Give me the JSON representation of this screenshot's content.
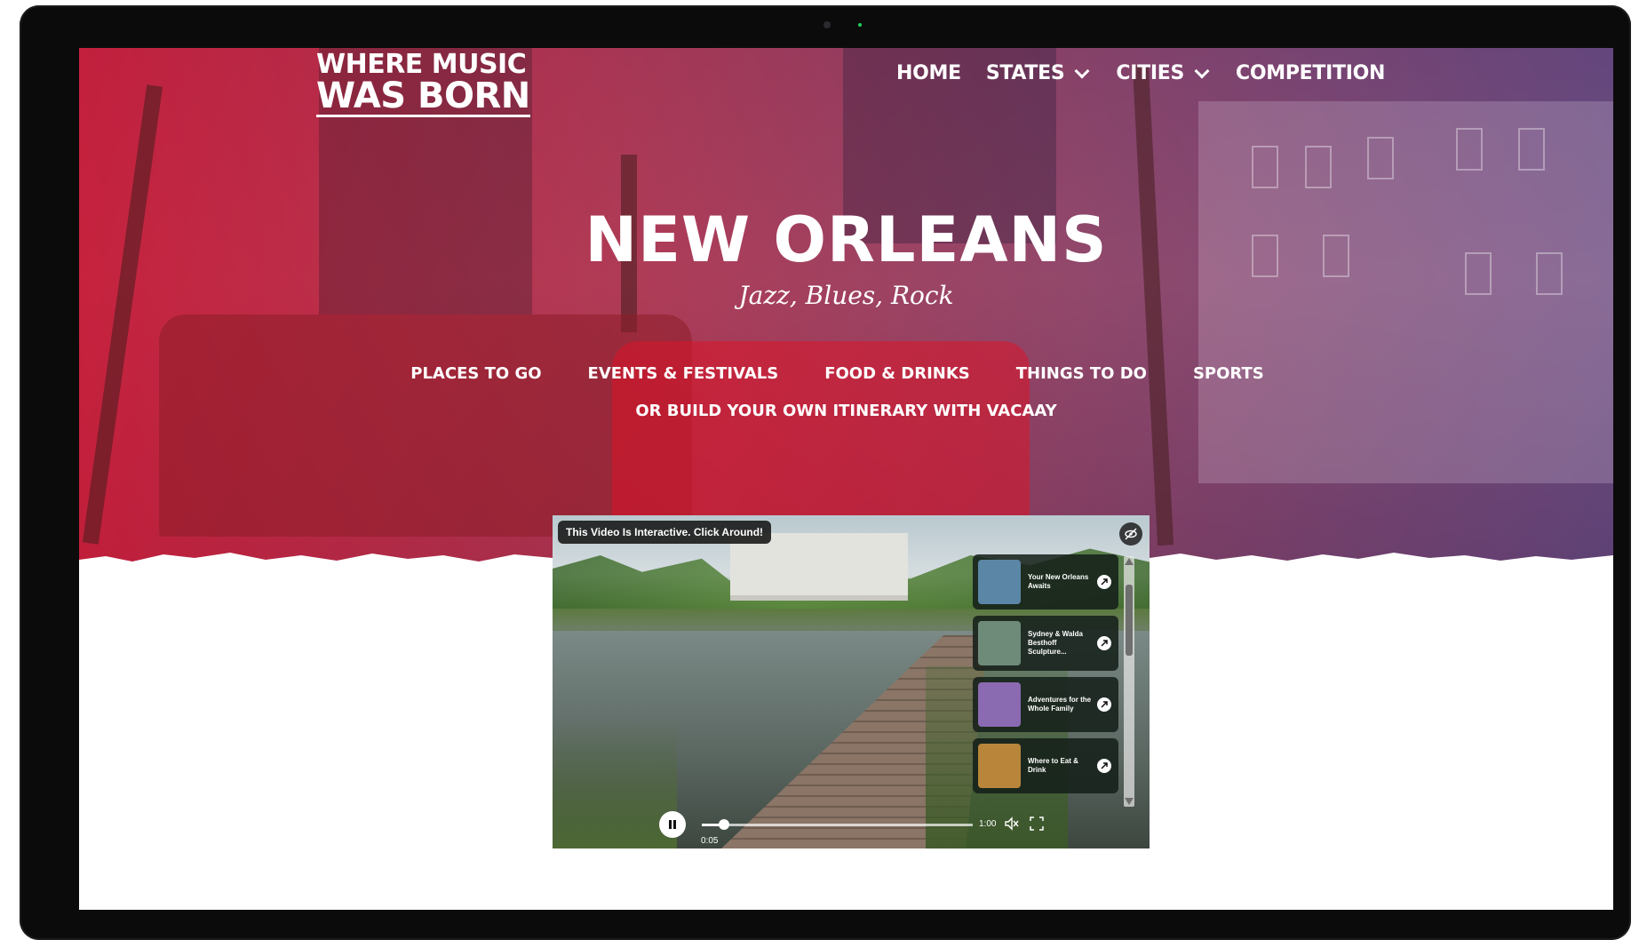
{
  "site": {
    "logo_line1": "WHERE MUSIC",
    "logo_line2": "WAS BORN"
  },
  "nav": {
    "home": "HOME",
    "states": "STATES",
    "cities": "CITIES",
    "competition": "COMPETITION"
  },
  "hero": {
    "title": "NEW ORLEANS",
    "subtitle": "Jazz, Blues, Rock"
  },
  "categories": {
    "places": "PLACES TO GO",
    "events": "EVENTS & FESTIVALS",
    "food": "FOOD & DRINKS",
    "things": "THINGS TO DO",
    "sports": "SPORTS",
    "itinerary": "OR BUILD YOUR OWN ITINERARY WITH VACAAY"
  },
  "video": {
    "badge": "This Video Is Interactive. Click Around!",
    "cards": [
      {
        "title": "Your New Orleans Awaits",
        "thumb_color": "#5b86a6"
      },
      {
        "title": "Sydney & Walda Besthoff Sculpture...",
        "thumb_color": "#6e8b79"
      },
      {
        "title": "Adventures for the Whole Family",
        "thumb_color": "#8a6ab0"
      },
      {
        "title": "Where to Eat & Drink",
        "thumb_color": "#b8853b"
      }
    ],
    "current_time": "0:05",
    "duration": "1:00",
    "progress": 0.083
  },
  "colors": {
    "hero_red": "#ce1838",
    "hero_purple": "#5f3c8c"
  }
}
